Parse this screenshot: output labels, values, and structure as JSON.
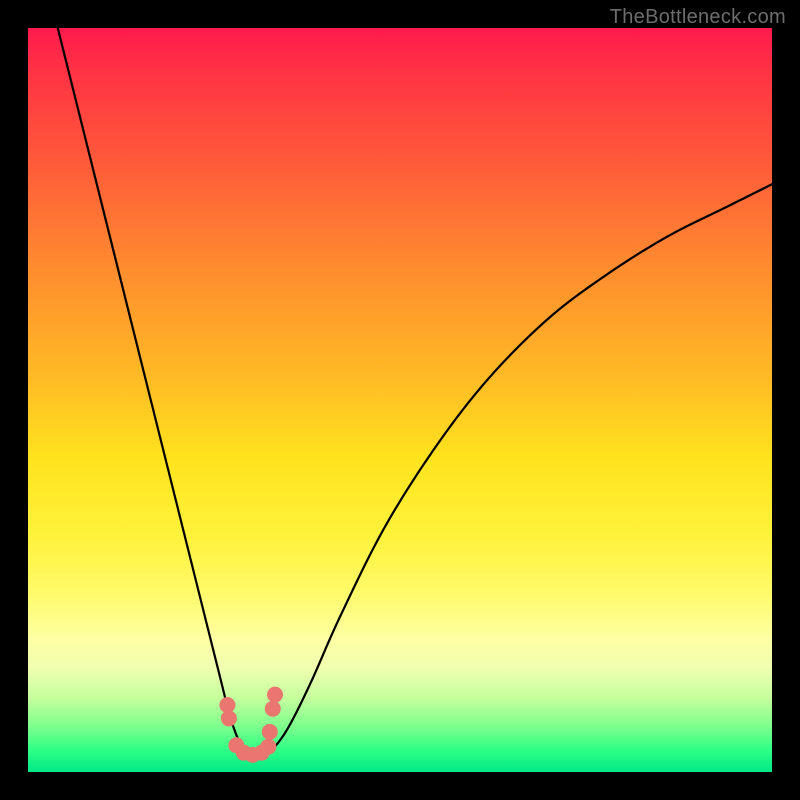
{
  "watermark": "TheBottleneck.com",
  "chart_data": {
    "type": "line",
    "title": "",
    "xlabel": "",
    "ylabel": "",
    "xlim": [
      0,
      100
    ],
    "ylim": [
      0,
      100
    ],
    "series": [
      {
        "name": "bottleneck-curve",
        "x": [
          4,
          6,
          8,
          10,
          12,
          14,
          16,
          18,
          20,
          22,
          24,
          26,
          27,
          28,
          29,
          30,
          31,
          32,
          33,
          35,
          38,
          42,
          48,
          55,
          62,
          70,
          78,
          86,
          94,
          100
        ],
        "y": [
          100,
          92,
          84,
          76,
          68,
          60,
          52,
          44,
          36,
          28,
          20,
          12,
          8,
          5,
          3,
          2.5,
          2.3,
          2.5,
          3.2,
          6,
          12,
          21,
          33,
          44,
          53,
          61,
          67,
          72,
          76,
          79
        ]
      },
      {
        "name": "marker-dots",
        "x": [
          26.8,
          27.0,
          28.0,
          29.0,
          30.2,
          31.4,
          32.3,
          32.5,
          32.9,
          33.2
        ],
        "y": [
          9.0,
          7.2,
          3.6,
          2.6,
          2.3,
          2.6,
          3.4,
          5.4,
          8.5,
          10.4
        ]
      }
    ],
    "colors": {
      "curve": "#000000",
      "markers": "#e9776f",
      "gradient_top": "#ff1a4d",
      "gradient_bottom": "#00e886"
    }
  }
}
